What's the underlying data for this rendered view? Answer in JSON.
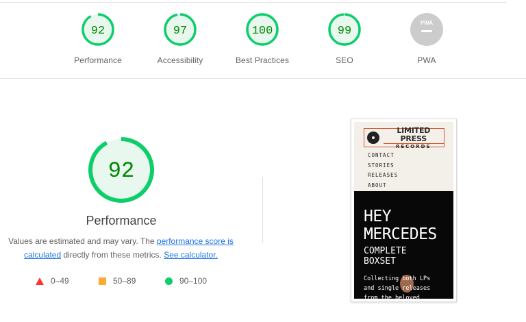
{
  "categories": [
    {
      "label": "Performance",
      "score": "92",
      "value": 92,
      "status": "pass"
    },
    {
      "label": "Accessibility",
      "score": "97",
      "value": 97,
      "status": "pass"
    },
    {
      "label": "Best Practices",
      "score": "100",
      "value": 100,
      "status": "pass"
    },
    {
      "label": "SEO",
      "score": "99",
      "value": 99,
      "status": "pass"
    },
    {
      "label": "PWA",
      "score": "",
      "value": null,
      "status": "na",
      "badge_text": "PWA"
    }
  ],
  "focus": {
    "score": "92",
    "value": 92,
    "label": "Performance"
  },
  "description": {
    "part1": "Values are estimated and may vary. The ",
    "link1": "performance score is calculated",
    "part2": " directly from these metrics. ",
    "link2": "See calculator."
  },
  "legend": [
    {
      "icon": "red-triangle-icon",
      "range": "0–49"
    },
    {
      "icon": "orange-square-icon",
      "range": "50–89"
    },
    {
      "icon": "green-circle-icon",
      "range": "90–100"
    }
  ],
  "screenshot": {
    "logo_line1": "LIMITED PRESS",
    "logo_line2": "RECORDS",
    "nav": [
      "CONTACT",
      "STORIES",
      "RELEASES",
      "ABOUT"
    ],
    "hero_line1": "HEY",
    "hero_line2": "MERCEDES",
    "hero_line3": "COMPLETE",
    "hero_line4": "BOXSET",
    "hero_body1": "Collecting both LPs",
    "hero_body2": "and single releases",
    "hero_body3": "from the beloved"
  },
  "colors": {
    "pass": "#0cce6b",
    "pass_text": "#008800",
    "pass_fill": "#e8f8ee",
    "na": "#cccccc",
    "link": "#1a73e8",
    "fail": "#ff3333",
    "average": "#ffaa33"
  }
}
